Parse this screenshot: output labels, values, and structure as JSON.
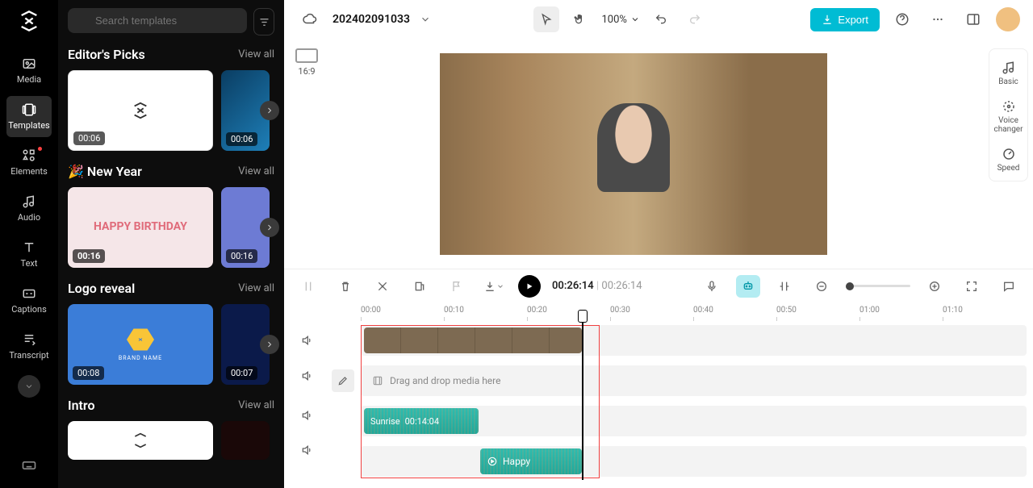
{
  "nav": {
    "items": [
      {
        "label": "Media"
      },
      {
        "label": "Templates"
      },
      {
        "label": "Elements"
      },
      {
        "label": "Audio"
      },
      {
        "label": "Text"
      },
      {
        "label": "Captions"
      },
      {
        "label": "Transcript"
      }
    ]
  },
  "templates": {
    "search_placeholder": "Search templates",
    "sections": [
      {
        "title": "Editor's Picks",
        "view_all": "View all",
        "cards": [
          {
            "duration": "00:06"
          },
          {
            "duration": "00:06"
          }
        ]
      },
      {
        "title": "🎉 New Year",
        "view_all": "View all",
        "cards": [
          {
            "duration": "00:16"
          },
          {
            "duration": "00:16"
          }
        ]
      },
      {
        "title": "Logo reveal",
        "view_all": "View all",
        "cards": [
          {
            "duration": "00:08"
          },
          {
            "duration": "00:07"
          }
        ]
      },
      {
        "title": "Intro",
        "view_all": "View all",
        "cards": [
          {
            "duration": ""
          },
          {
            "duration": ""
          }
        ]
      }
    ]
  },
  "header": {
    "project_name": "202402091033",
    "zoom": "100%",
    "export_label": "Export"
  },
  "canvas": {
    "aspect_label": "16:9"
  },
  "right_panel": {
    "tools": [
      {
        "label": "Basic"
      },
      {
        "label": "Voice changer"
      },
      {
        "label": "Speed"
      }
    ]
  },
  "timeline": {
    "current_time": "00:26:14",
    "total_time": "00:26:14",
    "ruler": [
      "00:00",
      "00:10",
      "00:20",
      "00:30",
      "00:40",
      "00:50",
      "01:00",
      "01:10"
    ],
    "drop_hint": "Drag and drop media here",
    "audio1_name": "Sunrise",
    "audio1_time": "00:14:04",
    "audio2_name": "Happy"
  },
  "birthday_text": "HAPPY BIRTHDAY",
  "brand_text": "BRAND NAME"
}
